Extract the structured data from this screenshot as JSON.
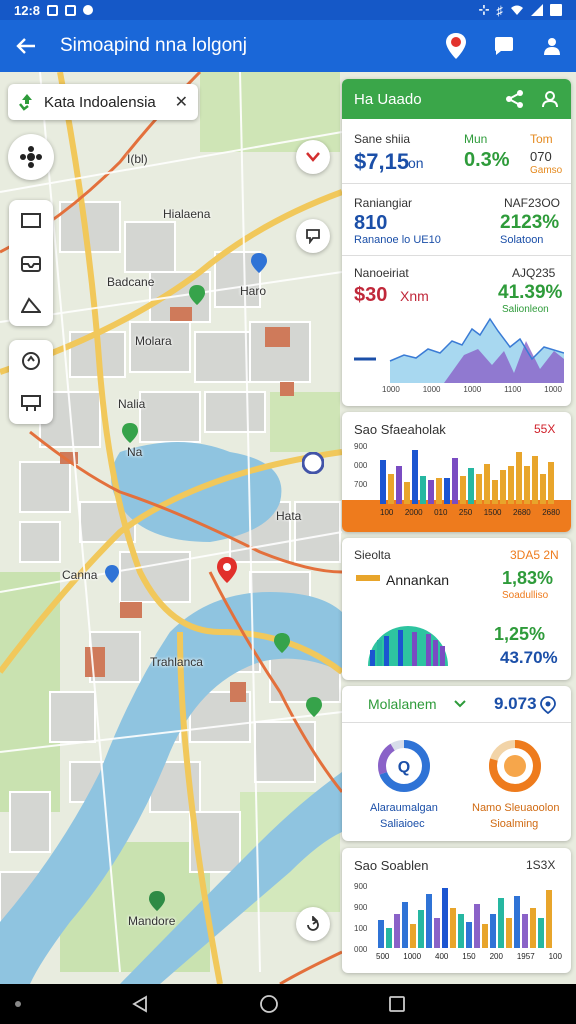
{
  "status_bar": {
    "time": "12:8",
    "colors": {
      "bar": "#1558c7"
    }
  },
  "app_bar": {
    "title": "Simoapind nna lolgonj",
    "background": "#1a67d8"
  },
  "map": {
    "search_chip": {
      "label": "Kata Indoalensia"
    },
    "labels": {
      "ibi": "I(bl)",
      "hialaena": "Hialaena",
      "badcane": "Badcane",
      "haro": "Haro",
      "molara": "Molara",
      "nalia": "Nalia",
      "na": "Na",
      "hata": "Hata",
      "canna": "Canna",
      "trahlanca": "Trahlanca",
      "mandore": "Mandore"
    },
    "colors": {
      "water": "#8fc4e0",
      "park": "#c9e2b0",
      "road_major": "#f1c85b",
      "road_arterial": "#e3703c"
    }
  },
  "panel": {
    "header": {
      "title": "Ha Uaado",
      "background": "#3aa649"
    },
    "stat1": {
      "label_a": "Sane shiia",
      "label_b": "Mun",
      "label_c": "Tom",
      "value": "$7,15",
      "unit": "on",
      "percent": "0.3%",
      "side_value": "070",
      "side_caption": "Gamso"
    },
    "stat2": {
      "label": "Raniangiar",
      "label_right": "NAF23OO",
      "value": "810",
      "sub": "Rananoe lo UE10",
      "percent": "2123%",
      "percent_caption": "Solatoon"
    },
    "stat3": {
      "label": "Nanoeiriat",
      "label_right": "AJQ235",
      "value": "$30",
      "unit": "Xnm",
      "percent": "41.39%",
      "percent_caption": "Salionleon",
      "axis": [
        "1000",
        "1000",
        "1000",
        "1100",
        "1000"
      ]
    },
    "bars1": {
      "title": "Sao Sfaeaholak",
      "badge": "55X",
      "yaxis": [
        "900",
        "000",
        "700",
        "100"
      ],
      "xaxis": [
        "100",
        "2000",
        "010",
        "250",
        "1500",
        "2680",
        "2680"
      ]
    },
    "gauge": {
      "label": "Sieolta",
      "label_right": "3DA5 2N",
      "title": "Annankan",
      "percent1": "1,83%",
      "caption1": "Soadulliso",
      "percent2": "1,25%",
      "percent3": "43.70%"
    },
    "donuts": {
      "header_left": "Molalanem",
      "header_right": "9.073",
      "left_title": "Alaraumalgan",
      "left_caption": "Saliaioec",
      "right_title": "Namo Sleuaoolon",
      "right_caption": "Sioalming"
    },
    "bars2": {
      "title": "Sao Soablen",
      "badge": "1S3X",
      "yaxis": [
        "900",
        "900",
        "100",
        "000"
      ],
      "xaxis": [
        "500",
        "1000",
        "400",
        "150",
        "200",
        "1957",
        "100"
      ]
    }
  },
  "colors": {
    "green": "#2e9b3a",
    "blue": "#1b4fa8",
    "red": "#d0202a",
    "orange": "#ee7b1d",
    "purple": "#7a4cc2",
    "teal": "#26b7a1"
  }
}
